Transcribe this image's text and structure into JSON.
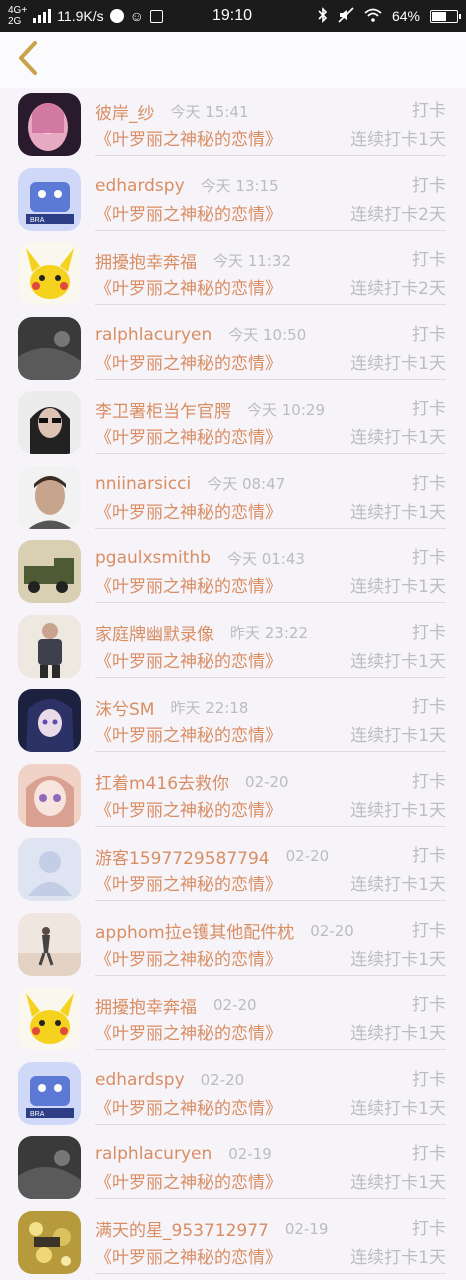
{
  "status_bar": {
    "network_top": "4G+",
    "network_bottom": "2G",
    "speed": "11.9K/s",
    "time": "19:10",
    "battery_text": "64%",
    "battery_level": 0.64,
    "icons": [
      "signal-icon",
      "baidu-icon",
      "qq-icon",
      "storage-icon",
      "bluetooth-icon",
      "mute-icon",
      "wifi-icon",
      "battery-icon"
    ]
  },
  "header": {
    "back_icon": "chevron-left-icon",
    "accent_color": "#c9a24a"
  },
  "colors": {
    "orange": "#d98d63",
    "gray": "#bdbdbd",
    "background": "#f6f4f8"
  },
  "entries": [
    {
      "name": "彼岸_纱",
      "time": "今天 15:41",
      "action": "打卡",
      "book": "《叶罗丽之神秘的恋情》",
      "streak": "连续打卡1天",
      "avatar": "anime-girl-pink"
    },
    {
      "name": "edhardspy",
      "time": "今天 13:15",
      "action": "打卡",
      "book": "《叶罗丽之神秘的恋情》",
      "streak": "连续打卡2天",
      "avatar": "cartoon-blue"
    },
    {
      "name": "拥擾抱幸奔福",
      "time": "今天 11:32",
      "action": "打卡",
      "book": "《叶罗丽之神秘的恋情》",
      "streak": "连续打卡2天",
      "avatar": "pikachu"
    },
    {
      "name": "ralphlacuryen",
      "time": "今天 10:50",
      "action": "打卡",
      "book": "《叶罗丽之神秘的恋情》",
      "streak": "连续打卡1天",
      "avatar": "dark-gray"
    },
    {
      "name": "李卫署柜当乍官腭",
      "time": "今天 10:29",
      "action": "打卡",
      "book": "《叶罗丽之神秘的恋情》",
      "streak": "连续打卡1天",
      "avatar": "woman-sunglasses"
    },
    {
      "name": "nniinarsicci",
      "time": "今天 08:47",
      "action": "打卡",
      "book": "《叶罗丽之神秘的恋情》",
      "streak": "连续打卡1天",
      "avatar": "man-portrait"
    },
    {
      "name": "pgaulxsmithb",
      "time": "今天 01:43",
      "action": "打卡",
      "book": "《叶罗丽之神秘的恋情》",
      "streak": "连续打卡1天",
      "avatar": "military-truck"
    },
    {
      "name": "家庭牌幽默录像",
      "time": "昨天 23:22",
      "action": "打卡",
      "book": "《叶罗丽之神秘的恋情》",
      "streak": "连续打卡1天",
      "avatar": "man-standing"
    },
    {
      "name": "沫兮SM",
      "time": "昨天 22:18",
      "action": "打卡",
      "book": "《叶罗丽之神秘的恋情》",
      "streak": "连续打卡1天",
      "avatar": "anime-dark"
    },
    {
      "name": "扛着m416去救你",
      "time": "02-20",
      "action": "打卡",
      "book": "《叶罗丽之神秘的恋情》",
      "streak": "连续打卡1天",
      "avatar": "anime-soft"
    },
    {
      "name": "游客1597729587794",
      "time": "02-20",
      "action": "打卡",
      "book": "《叶罗丽之神秘的恋情》",
      "streak": "连续打卡1天",
      "avatar": "default-user"
    },
    {
      "name": "apphom拉e镬其他配件枕",
      "time": "02-20",
      "action": "打卡",
      "book": "《叶罗丽之神秘的恋情》",
      "streak": "连续打卡1天",
      "avatar": "beach-person"
    },
    {
      "name": "拥擾抱幸奔福",
      "time": "02-20",
      "action": "打卡",
      "book": "《叶罗丽之神秘的恋情》",
      "streak": "连续打卡1天",
      "avatar": "pikachu"
    },
    {
      "name": "edhardspy",
      "time": "02-20",
      "action": "打卡",
      "book": "《叶罗丽之神秘的恋情》",
      "streak": "连续打卡1天",
      "avatar": "cartoon-blue"
    },
    {
      "name": "ralphlacuryen",
      "time": "02-19",
      "action": "打卡",
      "book": "《叶罗丽之神秘的恋情》",
      "streak": "连续打卡1天",
      "avatar": "dark-gray"
    },
    {
      "name": "满天的星_953712977",
      "time": "02-19",
      "action": "打卡",
      "book": "《叶罗丽之神秘的恋情》",
      "streak": "连续打卡1天",
      "avatar": "golden-sparkle"
    }
  ]
}
